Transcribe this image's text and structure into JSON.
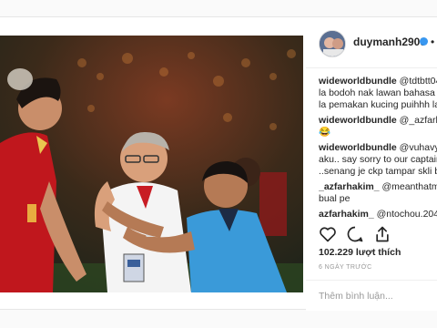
{
  "post": {
    "username": "duymanh2909",
    "header_rest": "• T",
    "likes": "102.229 lượt thích",
    "time_ago": "6 NGÀY TRƯỚC",
    "add_comment_placeholder": "Thêm bình luận..."
  },
  "comments": [
    {
      "user": "wideworldbundle",
      "text": "@tdtbtt04",
      "lines": [
        "la bodoh nak lawan bahasa k",
        "la pemakan kucing puihhh la"
      ]
    },
    {
      "user": "wideworldbundle",
      "text": "@_azfarha",
      "lines": [
        "😂"
      ]
    },
    {
      "user": "wideworldbundle",
      "text": "@vuhavy_",
      "lines": [
        "aku.. say sorry to our captain",
        "..senang je ckp tampar skli br"
      ]
    },
    {
      "user": "_azfarhakim_",
      "text": "@meanthatme",
      "lines": [
        "bual pe"
      ]
    },
    {
      "user": "azfarhakim_",
      "text": "@ntochou.204",
      "lines": []
    }
  ],
  "icons": {
    "like": "heart-icon",
    "comment": "comment-icon",
    "share": "share-icon",
    "verified": "verified-badge-icon"
  },
  "colors": {
    "accent": "#3897f0",
    "jersey_red": "#c0171d",
    "shirt_blue": "#3a9ad9"
  }
}
